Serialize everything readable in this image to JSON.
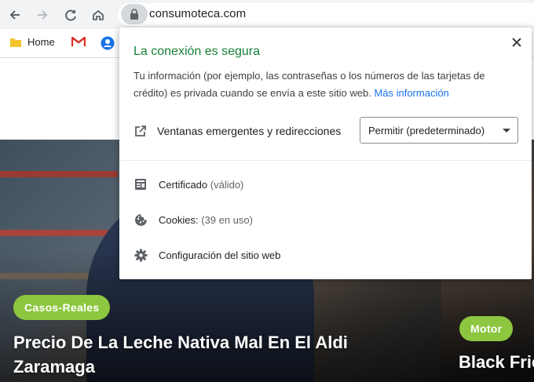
{
  "browser": {
    "url": "consumoteca.com",
    "bookmarks": [
      {
        "label": "Home",
        "icon": "folder-icon"
      },
      {
        "label": "",
        "icon": "gmail-icon"
      },
      {
        "label": "",
        "icon": "account-icon"
      }
    ]
  },
  "popup": {
    "title": "La conexión es segura",
    "description": "Tu información (por ejemplo, las contraseñas o los números de las tarjetas de crédito) es privada cuando se envía a este sitio web.",
    "more_info": "Más información",
    "permission": {
      "label": "Ventanas emergentes y redirecciones",
      "value": "Permitir (predeterminado)"
    },
    "rows": [
      {
        "label": "Certificado",
        "detail": "(válido)",
        "icon": "certificate-icon"
      },
      {
        "label": "Cookies:",
        "detail": "(39 en uso)",
        "icon": "cookie-icon"
      },
      {
        "label": "Configuración del sitio web",
        "detail": "",
        "icon": "gear-icon"
      }
    ],
    "colors": {
      "secure": "#188038",
      "link": "#1a73e8"
    }
  },
  "articles": [
    {
      "tag": "Casos-Reales",
      "title": "Precio De La Leche Nativa Mal En El Aldi Zaramaga"
    },
    {
      "tag": "Motor",
      "title": "Black Fric"
    }
  ],
  "colors": {
    "tag": "#8dc63f"
  }
}
